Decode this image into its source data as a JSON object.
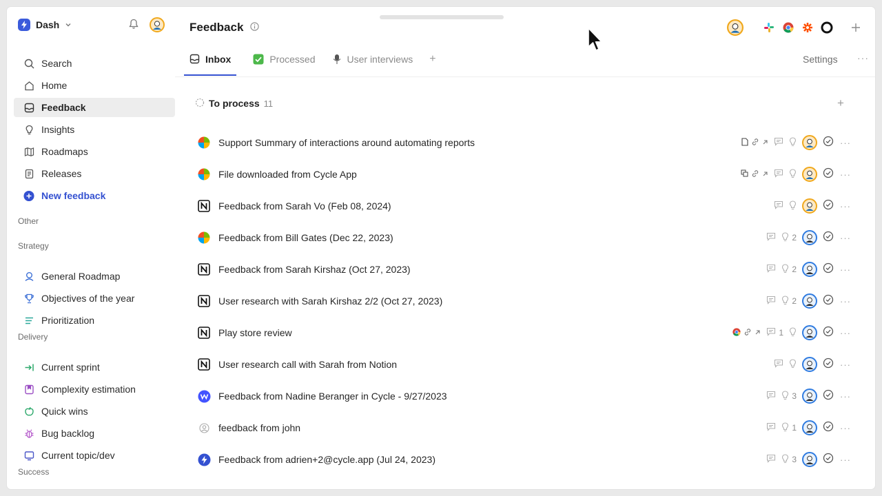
{
  "workspace": {
    "name": "Dash"
  },
  "sidebar": {
    "items": [
      {
        "label": "Search",
        "icon": "search-icon"
      },
      {
        "label": "Home",
        "icon": "home-icon"
      },
      {
        "label": "Feedback",
        "icon": "inbox-icon",
        "active": true
      },
      {
        "label": "Insights",
        "icon": "lightbulb-icon"
      },
      {
        "label": "Roadmaps",
        "icon": "map-icon"
      },
      {
        "label": "Releases",
        "icon": "document-icon"
      },
      {
        "label": "New feedback",
        "icon": "plus-circle-icon"
      }
    ],
    "sections": {
      "other": "Other",
      "strategy": "Strategy",
      "delivery": "Delivery",
      "success": "Success"
    },
    "strategy_items": [
      {
        "label": "General Roadmap",
        "icon": "roadmap-pin-icon"
      },
      {
        "label": "Objectives of the year",
        "icon": "trophy-icon"
      },
      {
        "label": "Prioritization",
        "icon": "list-icon"
      }
    ],
    "delivery_items": [
      {
        "label": "Current sprint",
        "icon": "arrow-right-bar-icon"
      },
      {
        "label": "Complexity estimation",
        "icon": "bookmark-icon"
      },
      {
        "label": "Quick wins",
        "icon": "apple-icon"
      },
      {
        "label": "Bug backlog",
        "icon": "bug-icon"
      },
      {
        "label": "Current topic/dev",
        "icon": "monitor-icon"
      }
    ]
  },
  "header": {
    "title": "Feedback"
  },
  "tabs": [
    {
      "label": "Inbox",
      "icon": "inbox-icon",
      "active": true
    },
    {
      "label": "Processed",
      "icon": "check-box-icon"
    },
    {
      "label": "User interviews",
      "icon": "microphone-icon"
    }
  ],
  "settings_label": "Settings",
  "group": {
    "label": "To process",
    "count": "11"
  },
  "rows": [
    {
      "title": "Support Summary of interactions around automating reports",
      "source": "microsoft",
      "counts": ""
    },
    {
      "title": "File downloaded from Cycle App",
      "source": "microsoft",
      "counts": ""
    },
    {
      "title": "Feedback from Sarah Vo (Feb 08, 2024)",
      "source": "notion",
      "counts": ""
    },
    {
      "title": "Feedback from Bill Gates (Dec 22, 2023)",
      "source": "microsoft",
      "counts": "2"
    },
    {
      "title": "Feedback from Sarah Kirshaz (Oct 27, 2023)",
      "source": "notion",
      "counts": "2"
    },
    {
      "title": "User research with Sarah Kirshaz 2/2 (Oct 27, 2023)",
      "source": "notion",
      "counts": "2"
    },
    {
      "title": "Play store review",
      "source": "notion",
      "counts": "",
      "comments": "1"
    },
    {
      "title": "User research call with Sarah from Notion",
      "source": "notion",
      "counts": ""
    },
    {
      "title": "Feedback from Nadine Beranger in Cycle - 9/27/2023",
      "source": "webflow",
      "counts": "3"
    },
    {
      "title": "feedback from john",
      "source": "user",
      "counts": "1"
    },
    {
      "title": "Feedback from adrien+2@cycle.app (Jul 24, 2023)",
      "source": "cycle",
      "counts": "3"
    }
  ],
  "colors": {
    "accent": "#3451d1",
    "brand": "#3b5bdb"
  }
}
